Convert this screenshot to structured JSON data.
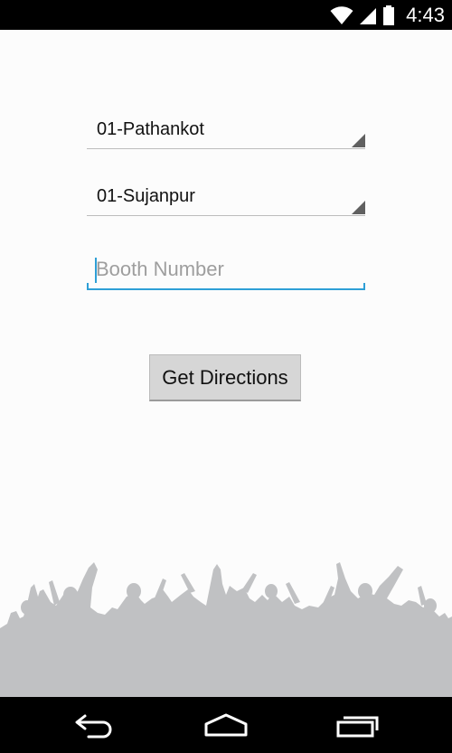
{
  "status_bar": {
    "time": "4:43",
    "icons": [
      "wifi-icon",
      "signal-icon",
      "battery-icon"
    ]
  },
  "form": {
    "district": {
      "value": "01-Pathankot"
    },
    "constituency": {
      "value": "01-Sujanpur"
    },
    "booth": {
      "placeholder": "Booth Number",
      "value": ""
    },
    "submit_label": "Get Directions"
  },
  "nav_bar": {
    "buttons": [
      "back-icon",
      "home-icon",
      "recents-icon"
    ]
  },
  "colors": {
    "accent": "#2e9fd6",
    "crowd": "#c0c1c3",
    "status_bar": "#000000"
  }
}
